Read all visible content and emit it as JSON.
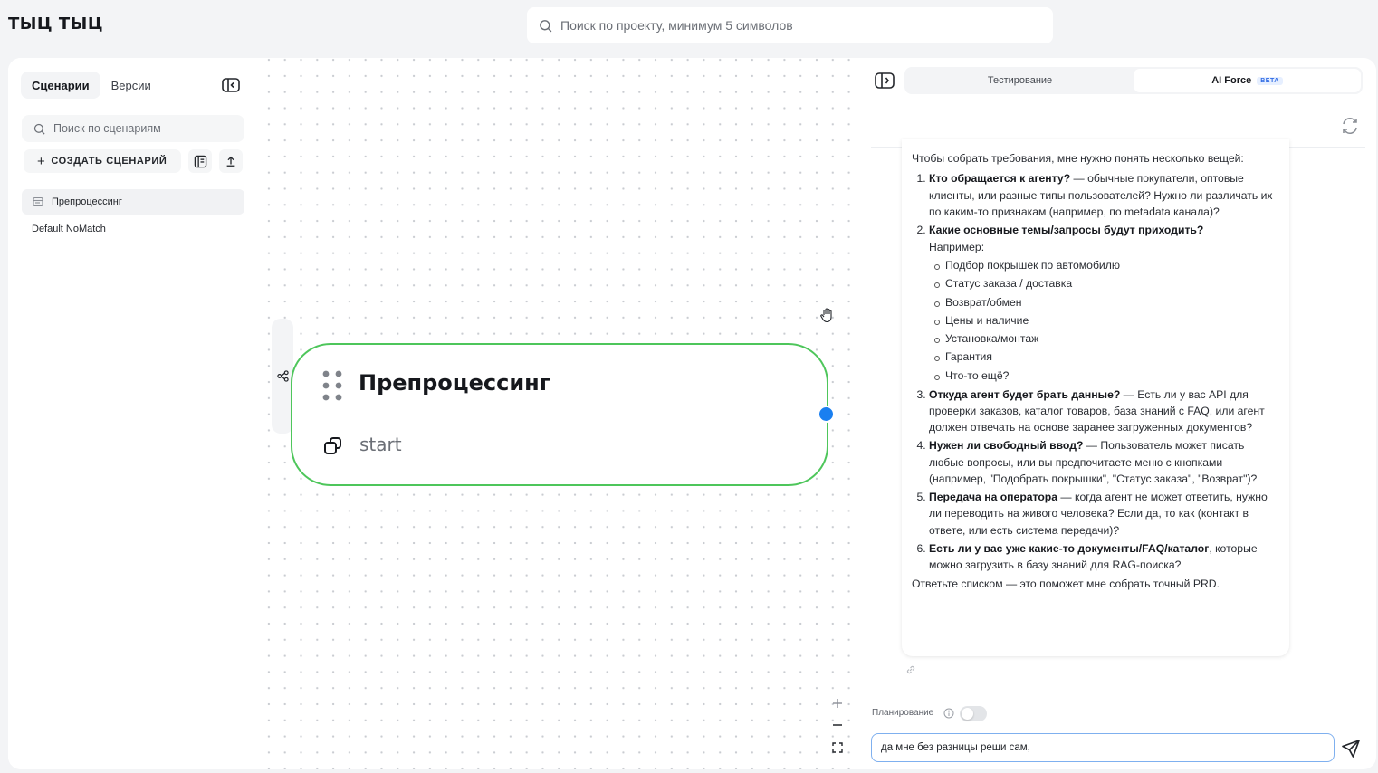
{
  "header": {
    "logo": "ТЫЦ ТЫЦ",
    "search_placeholder": "Поиск по проекту, минимум 5 символов"
  },
  "sidebar": {
    "tabs": [
      {
        "label": "Сценарии",
        "active": true
      },
      {
        "label": "Версии",
        "active": false
      }
    ],
    "search_placeholder": "Поиск по сценариям",
    "create_label": "СОЗДАТЬ СЦЕНАРИЙ",
    "scenarios": [
      {
        "label": "Препроцессинг",
        "active": true
      },
      {
        "label": "Default NoMatch",
        "active": false
      }
    ]
  },
  "canvas": {
    "node": {
      "title": "Препроцессинг",
      "subtitle": "start"
    },
    "colors": {
      "node_border": "#4ec65b",
      "port": "#1a7ff0"
    }
  },
  "right_panel": {
    "tabs": [
      {
        "label": "Тестирование",
        "active": false
      },
      {
        "label": "AI Force",
        "active": true,
        "badge": "BETA"
      }
    ],
    "message": {
      "intro": "Чтобы собрать требования, мне нужно понять несколько вещей:",
      "items": [
        {
          "title": "Кто обращается к агенту?",
          "text": " — обычные покупатели, оптовые клиенты, или разные типы пользователей? Нужно ли различать их по каким-то признакам (например, по metadata канала)?"
        },
        {
          "title": "Какие основные темы/запросы будут приходить?",
          "text": "Например:",
          "subitems": [
            "Подбор покрышек по автомобилю",
            "Статус заказа / доставка",
            "Возврат/обмен",
            "Цены и наличие",
            "Установка/монтаж",
            "Гарантия",
            "Что-то ещё?"
          ]
        },
        {
          "title": "Откуда агент будет брать данные?",
          "text": " — Есть ли у вас API для проверки заказов, каталог товаров, база знаний с FAQ, или агент должен отвечать на основе заранее загруженных документов?"
        },
        {
          "title": "Нужен ли свободный ввод?",
          "text": " — Пользователь может писать любые вопросы, или вы предпочитаете меню с кнопками (например, \"Подобрать покрышки\", \"Статус заказа\", \"Возврат\")?"
        },
        {
          "title": "Передача на оператора",
          "text": " — когда агент не может ответить, нужно ли переводить на живого человека? Если да, то как (контакт в ответе, или есть система передачи)?"
        },
        {
          "title": "Есть ли у вас уже какие-то документы/FAQ/каталог",
          "text": ", которые можно загрузить в базу знаний для RAG-поиска?"
        }
      ],
      "outro": "Ответьте списком — это поможет мне собрать точный PRD."
    },
    "planning_label": "Планирование",
    "planning_enabled": false,
    "input_value": "да мне без разницы реши сам,"
  }
}
